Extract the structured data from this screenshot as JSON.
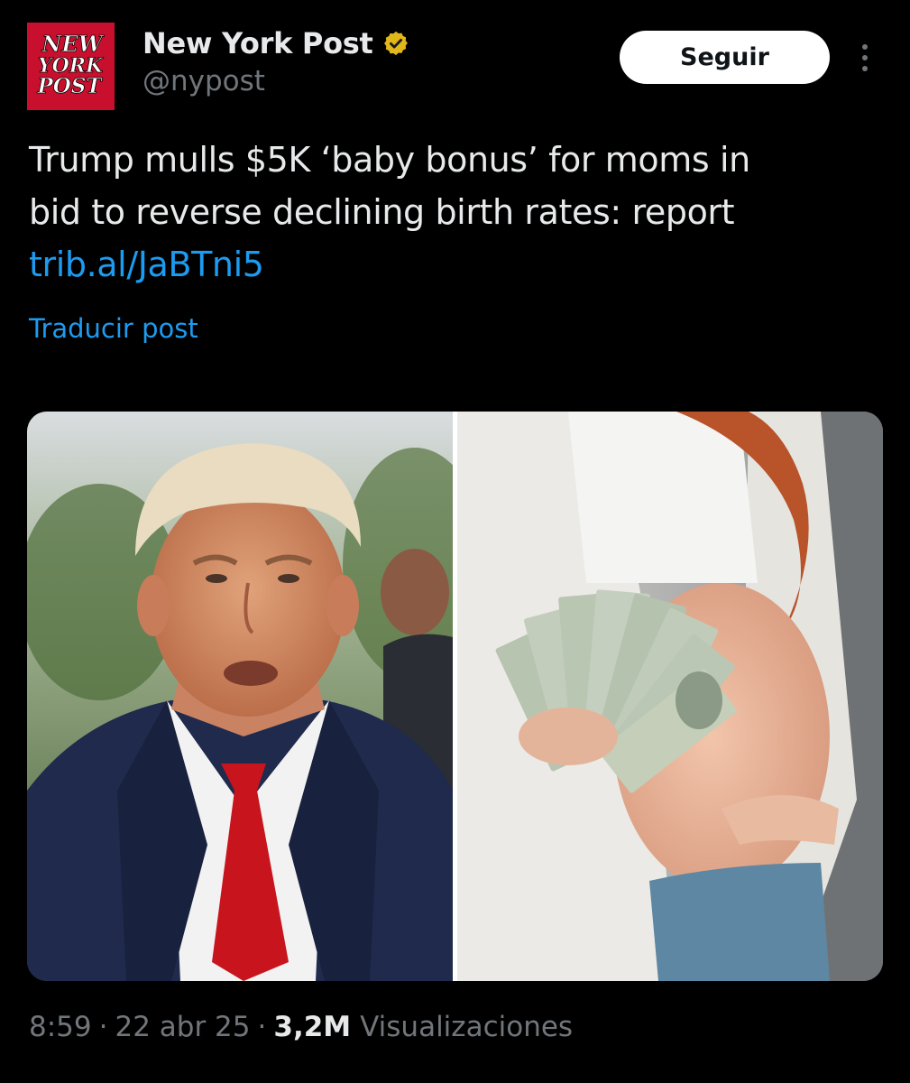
{
  "account": {
    "avatar_text": [
      "NEW",
      "YORK",
      "POST"
    ],
    "display_name": "New York Post",
    "handle": "@nypost",
    "verified_color": "#e2b719"
  },
  "actions": {
    "follow_label": "Seguir",
    "more_icon": "more-vertical-icon"
  },
  "post": {
    "text_lines": [
      "Trump mulls $5K ‘baby bonus’ for moms in",
      "bid to reverse declining birth rates: report"
    ],
    "link": "trib.al/JaBTni5",
    "translate_label": "Traducir post"
  },
  "media": {
    "left_image": "photo-man-in-suit-red-tie",
    "right_image": "photo-pregnant-woman-holding-dollar-bills"
  },
  "meta": {
    "time": "8:59",
    "separator": "·",
    "date": "22 abr 25",
    "views_count": "3,2M",
    "views_label": "Visualizaciones"
  },
  "colors": {
    "background": "#000000",
    "text_primary": "#e7e9ea",
    "text_secondary": "#71767b",
    "link": "#1d9bf0",
    "brand_red": "#c8102e"
  }
}
